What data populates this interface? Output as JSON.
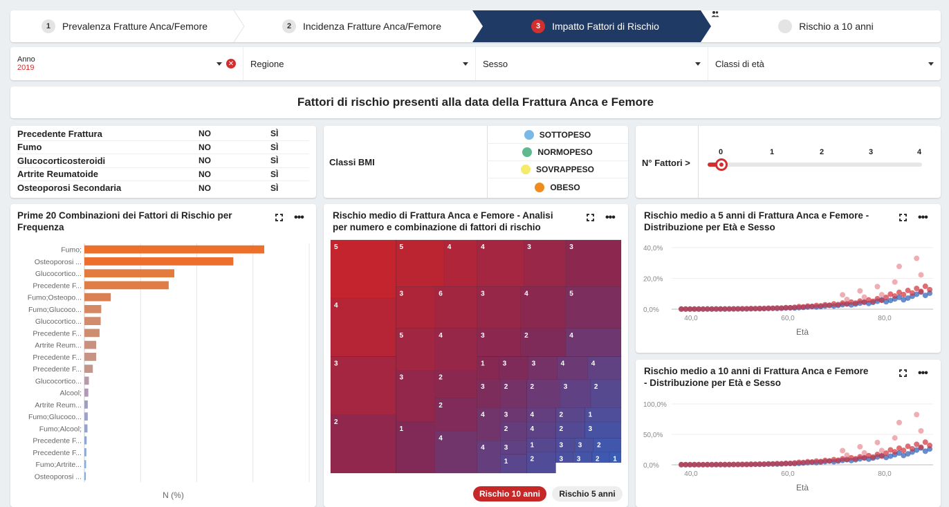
{
  "steps": [
    {
      "num": "1",
      "label": "Prevalenza Fratture Anca/Femore",
      "active": false
    },
    {
      "num": "2",
      "label": "Incidenza Fratture Anca/Femore",
      "active": false
    },
    {
      "num": "3",
      "label": "Impatto Fattori di Rischio",
      "active": true
    },
    {
      "num": "",
      "label": "Rischio a 10 anni",
      "icon": "people-icon",
      "active": false
    }
  ],
  "filters": {
    "anno": {
      "label": "Anno",
      "value": "2019"
    },
    "regione": {
      "label": "Regione"
    },
    "sesso": {
      "label": "Sesso"
    },
    "classi": {
      "label": "Classi di età"
    }
  },
  "main_title": "Fattori di rischio presenti alla data della Frattura Anca e Femore",
  "risk_factors": {
    "no_label": "NO",
    "si_label": "SÌ",
    "items": [
      "Precedente Frattura",
      "Fumo",
      "Glucocorticosteroidi",
      "Artrite Reumatoide",
      "Osteoporosi Secondaria"
    ]
  },
  "bmi": {
    "label": "Classi BMI",
    "classes": [
      {
        "name": "SOTTOPESO",
        "color": "#7ab8e8"
      },
      {
        "name": "NORMOPESO",
        "color": "#5fb88f"
      },
      {
        "name": "SOVRAPPESO",
        "color": "#f5ea6a"
      },
      {
        "name": "OBESO",
        "color": "#f08c1e"
      }
    ]
  },
  "n_fattori": {
    "label": "N° Fattori >",
    "ticks": [
      "0",
      "1",
      "2",
      "3",
      "4"
    ],
    "value": 0
  },
  "bar_panel": {
    "title_line1": "Prime 20 Combinazioni dei Fattori di Rischio per",
    "title_line2": "Frequenza",
    "xlabel": "N (%)"
  },
  "tree_panel": {
    "title_line1": "Rischio medio di Frattura Anca e Femore - Analisi",
    "title_line2": "per numero e combinazione di fattori di rischio",
    "toggle_on": "Rischio 10 anni",
    "toggle_off": "Rischio 5 anni"
  },
  "scatter5": {
    "title_line1": "Rischio medio a 5 anni di Frattura Anca e Femore -",
    "title_line2": "Distribuzione per Età e Sesso"
  },
  "scatter10": {
    "title_line1": "Rischio medio a 10 anni di Frattura Anca e Femore",
    "title_line2": "- Distribuzione per Età e Sesso"
  },
  "chart_data": [
    {
      "type": "bar",
      "orientation": "horizontal",
      "xlabel": "N (%)",
      "categories": [
        "Fumo;",
        "Osteoporosi ...",
        "Glucocortico...",
        "Precedente F...",
        "Fumo;Osteopo...",
        "Fumo;Glucoco...",
        "Glucocortico...",
        "Precedente F...",
        "Artrite Reum...",
        "Precedente F...",
        "Precedente F...",
        "Glucocortico...",
        "Alcool;",
        "Artrite Reum...",
        "Fumo;Glucoco...",
        "Fumo;Alcool;",
        "Precedente F...",
        "Precedente F...",
        "Fumo;Artrite...",
        "Osteoporosi ..."
      ],
      "values": [
        32,
        26.5,
        16,
        15,
        4.7,
        3,
        2.9,
        2.7,
        2.1,
        2.1,
        1.5,
        0.8,
        0.7,
        0.6,
        0.6,
        0.55,
        0.4,
        0.35,
        0.3,
        0.25
      ],
      "xlim": [
        0,
        40
      ],
      "colors": [
        "#ed6f2a",
        "#ec6f2e",
        "#e37b3f",
        "#e07c45",
        "#d98055",
        "#d48864",
        "#d08c6c",
        "#cc8d70",
        "#c99080",
        "#c69385",
        "#c3968c",
        "#b59aa8",
        "#ae9ab5",
        "#a09ebf",
        "#9ea1c8",
        "#95a4cd",
        "#8fa6d4",
        "#8aa8d8",
        "#86aadb",
        "#82acdf"
      ]
    },
    {
      "type": "treemap",
      "values": [
        5,
        5,
        4,
        4,
        3,
        3,
        4,
        3,
        6,
        3,
        4,
        5,
        3,
        5,
        4,
        3,
        2,
        4,
        2,
        3,
        2,
        1,
        3,
        3,
        4,
        4,
        2,
        3,
        2,
        2,
        3,
        2,
        1,
        4,
        4,
        3,
        4,
        2,
        1,
        2,
        4,
        2,
        3,
        4,
        3,
        1,
        3,
        3,
        2,
        1,
        2,
        3,
        3,
        2,
        1
      ]
    },
    {
      "type": "scatter",
      "title": "Rischio medio a 5 anni di Frattura Anca e Femore - Distribuzione per Età e Sesso",
      "xlabel": "Età",
      "xticks": [
        "40,0",
        "60,0",
        "80,0"
      ],
      "yticks": [
        "0,0%",
        "20,0%",
        "40,0%"
      ],
      "xlim": [
        36,
        90
      ],
      "ylim": [
        0,
        40
      ]
    },
    {
      "type": "scatter",
      "title": "Rischio medio a 10 anni di Frattura Anca e Femore - Distribuzione per Età e Sesso",
      "xlabel": "Età",
      "xticks": [
        "40,0",
        "60,0",
        "80,0"
      ],
      "yticks": [
        "0,0%",
        "50,0%",
        "100,0%"
      ],
      "xlim": [
        36,
        90
      ],
      "ylim": [
        0,
        100
      ]
    }
  ]
}
